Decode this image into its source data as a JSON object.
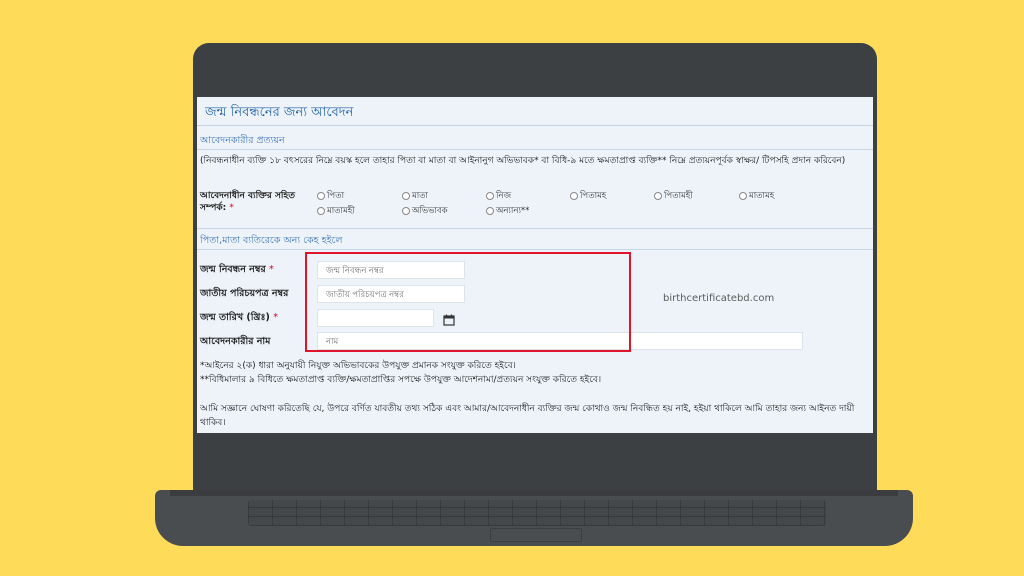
{
  "form": {
    "title": "জন্ম নিবন্ধনের জন্য আবেদন",
    "applicant_section": "আবেদনকারীর প্রত্যয়ন",
    "applicant_instruction": "(নিবন্ধনাধীন ব্যক্তি ১৮ বৎসরের নিম্নে বয়স্ক হলে তাহার পিতা বা মাতা বা আইনানুগ অভিভাবক* বা বিধি-৯ মতে ক্ষমতাপ্রাপ্ত ব্যক্তি** নিম্নে প্রত্যয়নপূর্বক স্বাক্ষর/ টিপসহি প্রদান করিবেন)",
    "relation_label": "আবেদনাধীন ব্যক্তির সহিত সম্পর্ক:",
    "relation_required": "*",
    "relation_options": [
      "পিতা",
      "মাতা",
      "নিজ",
      "পিতামহ",
      "পিতামহী",
      "মাতামহ",
      "মাতামহী",
      "অভিভাবক",
      "অন্যান্য**"
    ],
    "other_section": "পিতা,মাতা ব্যতিরেকে অন্য কেহ হইলে",
    "fields": {
      "birth_reg_label": "জন্ম নিবন্ধন নম্বর",
      "birth_reg_placeholder": "জন্ম নিবন্ধন নম্বর",
      "nid_label": "জাতীয় পরিচয়পত্র নম্বর",
      "nid_placeholder": "জাতীয় পরিচয়পত্র নম্বর",
      "dob_label": "জন্ম তারিখ (খ্রিঃ)",
      "dob_value": "",
      "name_label": "আবেদনকারীর নাম",
      "name_placeholder": "নাম",
      "required_mark": "*"
    },
    "note_1": "*আইনের ২(ক) ধারা অনুযায়ী নিযুক্ত অভিভাবকের উপযুক্ত প্রমানক সংযুক্ত করিতে হইবে।",
    "note_2": "**বিধিমালার ৯ বিধিতে ক্ষমতাপ্রাপ্ত ব্যক্তি/ক্ষমতাপ্রাপ্তির সপক্ষে উপযুক্ত আদেশনামা/প্রত্যয়ন সংযুক্ত করিতে হইবে।",
    "declaration": "আমি সজ্ঞানে ঘোষণা করিতেছি যে, উপরে বর্ণিত যাবতীয় তথ্য সঠিক এবং আমার/আবেদনাধীন ব্যক্তির জন্ম কোথাও জন্ম নিবন্ধিত হয় নাই, হইয়া থাকিলে আমি তাহার জন্য আইনত দায়ী থাকিব।"
  },
  "watermark": "birthcertificatebd.com",
  "colors": {
    "background": "#fedc5a",
    "laptop": "#3c4043",
    "screen": "#edf3f9",
    "title_blue": "#1f61a8",
    "highlight_red": "#e2142b"
  }
}
